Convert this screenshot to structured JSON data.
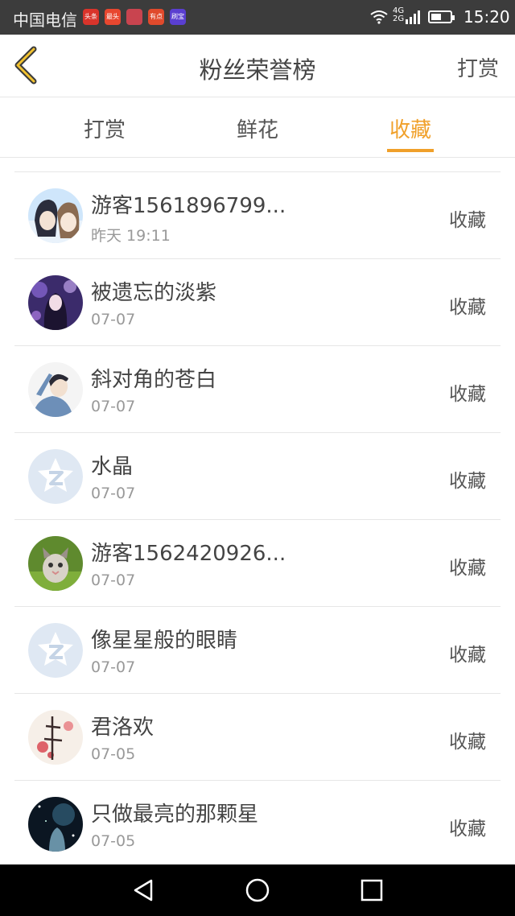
{
  "status_bar": {
    "carrier": "中国电信",
    "notifications": [
      {
        "label": "头条",
        "color": "#d9342b"
      },
      {
        "label": "最头条",
        "color": "#e8472f"
      },
      {
        "label": "",
        "color": "#c9444f"
      },
      {
        "label": "有点",
        "color": "#e04a2c"
      },
      {
        "label": "刷宝",
        "color": "#5a3fd0"
      }
    ],
    "network": "4G 2G",
    "time": "15:20"
  },
  "header": {
    "title": "粉丝荣誉榜",
    "action": "打赏"
  },
  "tabs": [
    {
      "label": "打赏",
      "active": false
    },
    {
      "label": "鲜花",
      "active": false
    },
    {
      "label": "收藏",
      "active": true
    }
  ],
  "list": [
    {
      "name": "游客1561896799...",
      "time": "昨天 19:11",
      "action": "收藏",
      "avatar": "photo-couple"
    },
    {
      "name": "被遗忘的淡紫",
      "time": "07-07",
      "action": "收藏",
      "avatar": "photo-purple-girl"
    },
    {
      "name": "斜对角的苍白",
      "time": "07-07",
      "action": "收藏",
      "avatar": "photo-boy-sketch"
    },
    {
      "name": "水晶",
      "time": "07-07",
      "action": "收藏",
      "avatar": "default-avatar"
    },
    {
      "name": "游客1562420926...",
      "time": "07-07",
      "action": "收藏",
      "avatar": "photo-kitten"
    },
    {
      "name": "像星星般的眼睛",
      "time": "07-07",
      "action": "收藏",
      "avatar": "default-avatar"
    },
    {
      "name": "君洛欢",
      "time": "07-05",
      "action": "收藏",
      "avatar": "photo-calligraphy"
    },
    {
      "name": "只做最亮的那颗星",
      "time": "07-05",
      "action": "收藏",
      "avatar": "photo-night-sky"
    }
  ],
  "colors": {
    "accent": "#f0a02a",
    "status_bar": "#3c3c3c",
    "nav_bar": "#000000"
  }
}
